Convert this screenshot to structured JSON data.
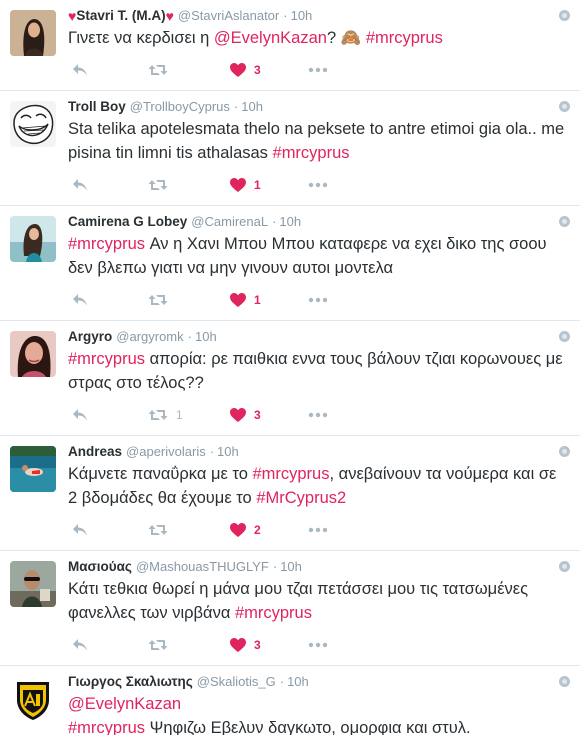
{
  "colors": {
    "accent": "#e0245e",
    "muted": "#8899a6",
    "icon": "#aab8c2"
  },
  "tweets": [
    {
      "name": "Stavri T. (M.A)",
      "name_hearts": true,
      "username": "@StavriAslanator",
      "time": "10h",
      "parts": [
        {
          "t": "Γινετε να κερδισει η "
        },
        {
          "t": "@EvelynKazan",
          "k": "mention"
        },
        {
          "t": "? 🙈 "
        },
        {
          "t": "#mrcyprus",
          "k": "tag"
        }
      ],
      "retweets": "",
      "likes": "3",
      "avatar": "woman-dark-hair"
    },
    {
      "name": "Troll Boy",
      "username": "@TrollboyCyprus",
      "time": "10h",
      "parts": [
        {
          "t": "Sta telika apotelesmata thelo na peksete to antre etimoi gia ola.. me pisina tin limni tis athalasas "
        },
        {
          "t": "#mrcyprus",
          "k": "tag"
        }
      ],
      "retweets": "",
      "likes": "1",
      "avatar": "trollface"
    },
    {
      "name": "Camirena G Lobey",
      "username": "@CamirenaL",
      "time": "10h",
      "parts": [
        {
          "t": "#mrcyprus",
          "k": "tag"
        },
        {
          "t": " Αν η Χανι Μπου Μπου καταφερε να εχει δικο της σοου δεν βλεπω γιατι να μην γινουν αυτοι μοντελα"
        }
      ],
      "retweets": "",
      "likes": "1",
      "avatar": "girl-teal"
    },
    {
      "name": "Argyro",
      "username": "@argyromk",
      "time": "10h",
      "parts": [
        {
          "t": "#mrcyprus",
          "k": "tag"
        },
        {
          "t": " απορία: ρε παιθκια εννα τους βάλουν τζιαι κορωνουες με στρας στο τέλος??"
        }
      ],
      "retweets": "1",
      "likes": "3",
      "avatar": "woman-pink"
    },
    {
      "name": "Andreas",
      "username": "@aperivolaris",
      "time": "10h",
      "parts": [
        {
          "t": "Κάμνετε παναΰρκα με το "
        },
        {
          "t": "#mrcyprus",
          "k": "tag"
        },
        {
          "t": ", ανεβαίνουν τα νούμερα και σε 2 βδομάδες θα έχουμε το "
        },
        {
          "t": "#MrCyprus2",
          "k": "tag"
        }
      ],
      "retweets": "",
      "likes": "2",
      "avatar": "swimmer-sea"
    },
    {
      "name": "Μασιούας",
      "username": "@MashouasTHUGLYF",
      "time": "10h",
      "parts": [
        {
          "t": "Κάτι τεθκια θωρεί η μάνα μου τζαι πετάσσει μου τις τατσωμένες φανελλες των νιρβάνα "
        },
        {
          "t": "#mrcyprus",
          "k": "tag"
        }
      ],
      "retweets": "",
      "likes": "3",
      "avatar": "man-sunglasses"
    },
    {
      "name": "Γιωργος Σκαλιωτης",
      "username": "@Skaliotis_G",
      "time": "10h",
      "parts": [
        {
          "t": "@EvelynKazan",
          "k": "mention"
        },
        {
          "t": "\n "
        },
        {
          "t": "#mrcyprus",
          "k": "tag"
        },
        {
          "t": " Ψηφιζω Εβελυν δαγκωτο, ομορφια και στυλ."
        }
      ],
      "retweets": "",
      "likes": "",
      "avatar": "aris-crest"
    }
  ]
}
